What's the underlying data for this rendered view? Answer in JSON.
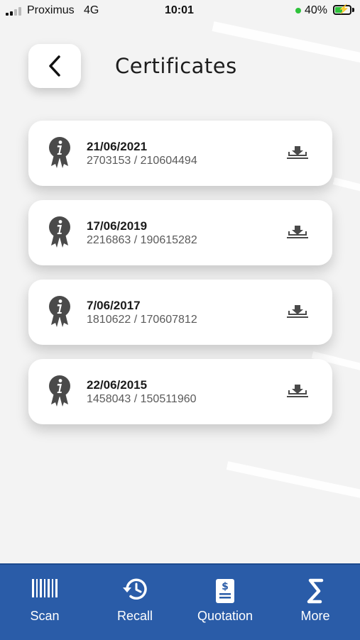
{
  "status_bar": {
    "carrier": "Proximus",
    "network": "4G",
    "time": "10:01",
    "battery": "40%"
  },
  "header": {
    "title": "Certificates",
    "back_icon": "chevron-left-icon"
  },
  "certificates": [
    {
      "date": "21/06/2021",
      "numbers": "2703153 / 210604494"
    },
    {
      "date": "17/06/2019",
      "numbers": "2216863 / 190615282"
    },
    {
      "date": "7/06/2017",
      "numbers": "1810622 / 170607812"
    },
    {
      "date": "22/06/2015",
      "numbers": "1458043 / 150511960"
    }
  ],
  "nav": {
    "scan": "Scan",
    "recall": "Recall",
    "quotation": "Quotation",
    "more": "More"
  },
  "colors": {
    "nav_background": "#2a5ca8",
    "icon_gray": "#4a4a4a",
    "battery_green": "#2ec23b"
  }
}
